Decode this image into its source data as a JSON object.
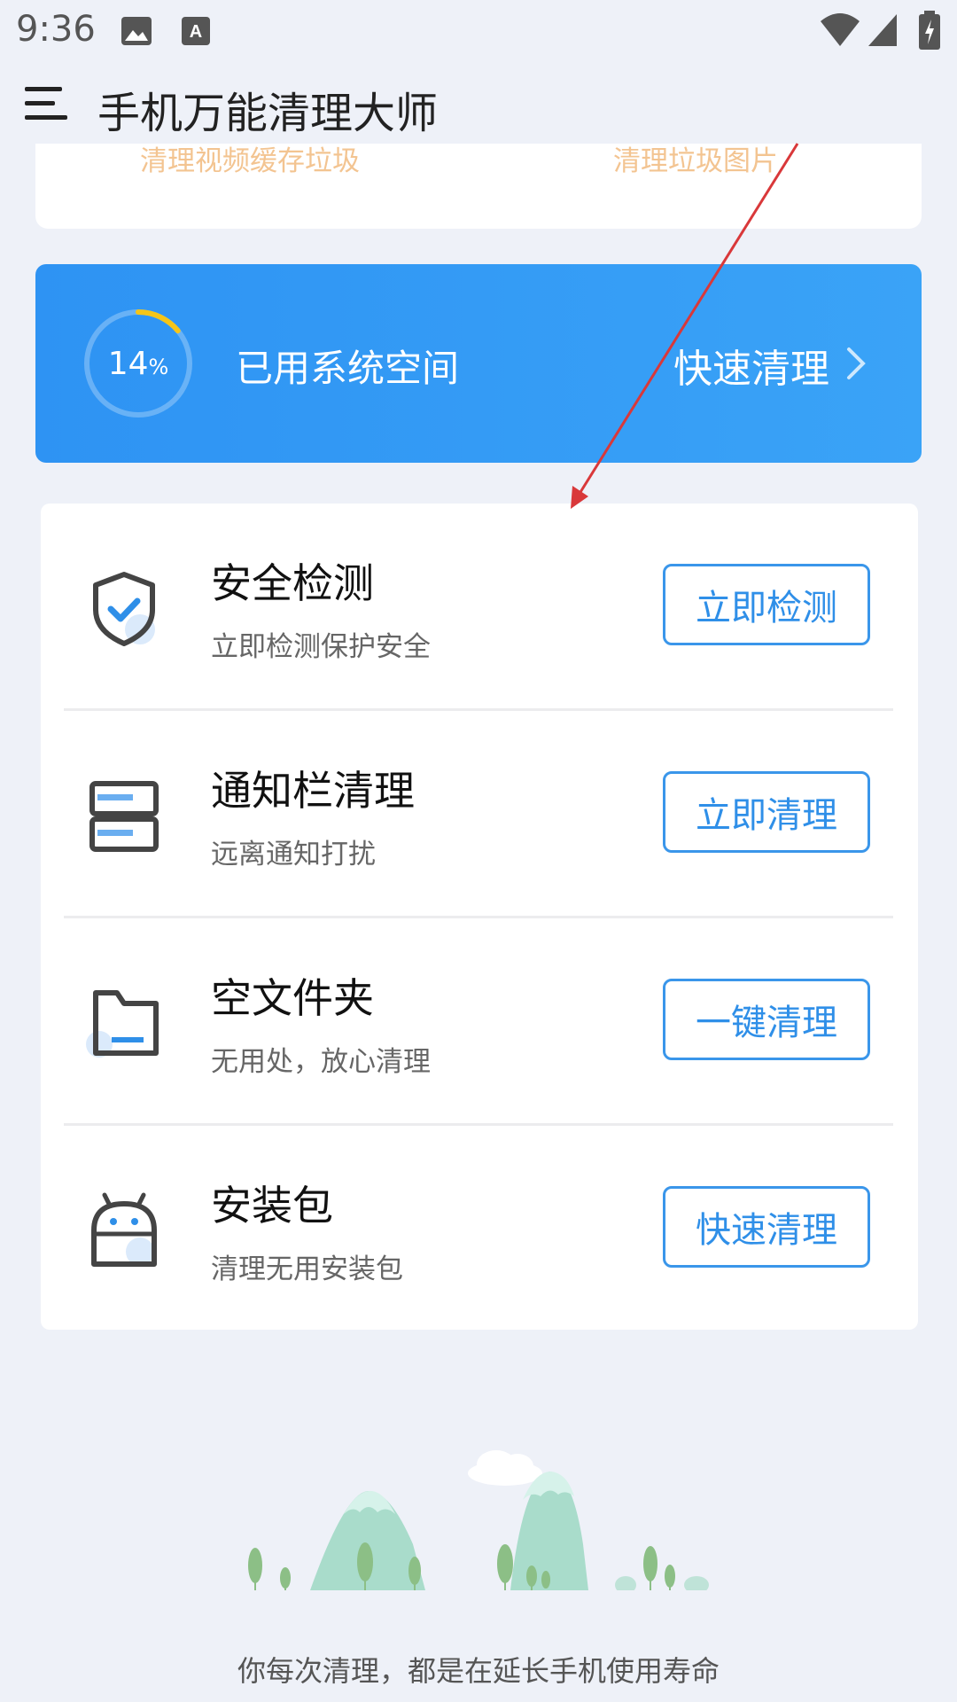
{
  "status_bar": {
    "time": "9:36",
    "icons": [
      "image-icon",
      "text-icon",
      "wifi-icon",
      "signal-icon",
      "battery-charging-icon"
    ]
  },
  "app_bar": {
    "title": "手机万能清理大师",
    "menu_icon": "menu-icon"
  },
  "top_card": {
    "left_text": "清理视频缓存垃圾",
    "right_text": "清理垃圾图片"
  },
  "banner": {
    "percent": "14",
    "percent_unit": "%",
    "used_fraction": 0.14,
    "label": "已用系统空间",
    "action": "快速清理",
    "ring_color": "#f5c518"
  },
  "items": [
    {
      "icon": "shield-check-icon",
      "title": "安全检测",
      "subtitle": "立即检测保护安全",
      "button": "立即检测"
    },
    {
      "icon": "notification-bar-icon",
      "title": "通知栏清理",
      "subtitle": "远离通知打扰",
      "button": "立即清理"
    },
    {
      "icon": "folder-icon",
      "title": "空文件夹",
      "subtitle": "无用处，放心清理",
      "button": "一键清理"
    },
    {
      "icon": "android-package-icon",
      "title": "安装包",
      "subtitle": "清理无用安装包",
      "button": "快速清理"
    }
  ],
  "footer": {
    "text": "你每次清理，都是在延长手机使用寿命"
  },
  "colors": {
    "accent": "#2f8fe8",
    "banner": "#3aa3f7",
    "background": "#eef1f8",
    "annotation_arrow": "#d9383a"
  }
}
